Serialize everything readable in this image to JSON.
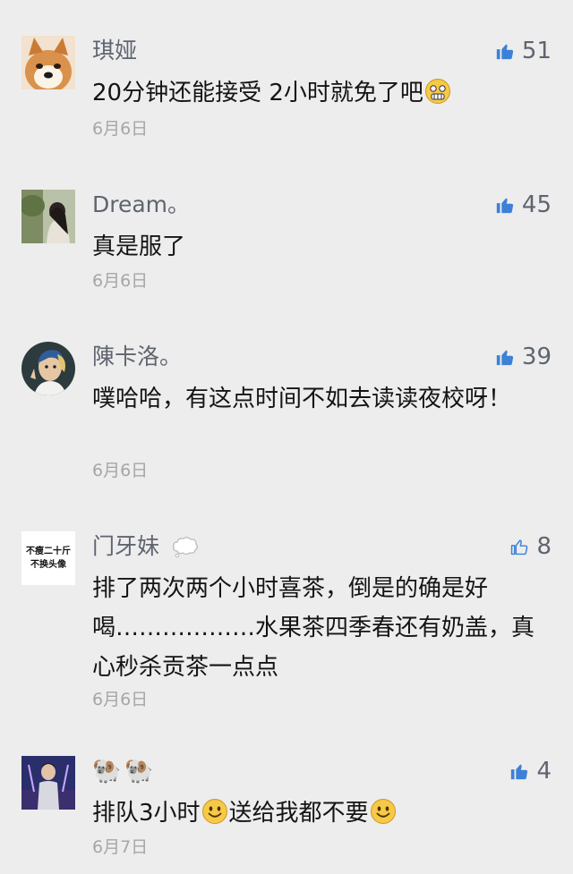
{
  "colors": {
    "background": "#ededed",
    "name": "#5f6470",
    "date": "#a6a6a6",
    "like": "#3d81d6"
  },
  "comments": [
    {
      "name": "琪娅",
      "text": "20分钟还能接受  2小时就免了吧",
      "emoji": "grimace-emoji",
      "date": "6月6日",
      "likes": "51",
      "liked": true
    },
    {
      "name": "Dream。",
      "text": "真是服了",
      "date": "6月6日",
      "likes": "45",
      "liked": true
    },
    {
      "name": "陳卡洛。",
      "text": "噗哈哈，有这点时间不如去读读夜校呀！",
      "date": "6月6日",
      "likes": "39",
      "liked": true
    },
    {
      "name": "门牙妹",
      "name_icon": "speech-bubble-icon",
      "avatar_text": [
        "不瘦二十斤",
        "不换头像"
      ],
      "text": "排了两次两个小时喜茶，倒是的确是好喝………………水果茶四季春还有奶盖，真心秒杀贡茶一点点",
      "date": "6月6日",
      "likes": "8",
      "liked": false
    },
    {
      "name": "🐏🐏",
      "text_parts": [
        "排队3小时",
        "送给我都不要"
      ],
      "date": "6月7日",
      "likes": "4",
      "liked": true
    }
  ]
}
